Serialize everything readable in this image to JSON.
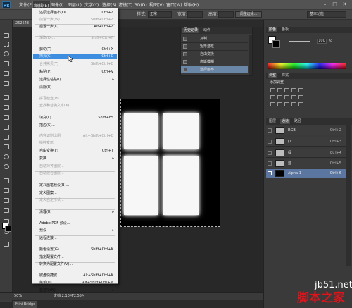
{
  "app": {
    "logo": "Ps",
    "menus": [
      "文件(F)",
      "编辑(E)",
      "图像(I)",
      "图层(L)",
      "文字(Y)",
      "选择(S)",
      "滤镜(T)",
      "3D(D)",
      "视图(V)",
      "窗口(W)",
      "帮助(H)"
    ],
    "window_buttons": [
      "–",
      "□",
      "✕"
    ]
  },
  "options_bar": {
    "style_label": "样式:",
    "style_value": "正常",
    "width_label": "宽度:",
    "height_label": "高度:",
    "refine_edge": "调整边缘...",
    "workspace": "基本功能"
  },
  "document": {
    "tab_label": "262643",
    "bottom_tab": "Mini Bridge"
  },
  "edit_menu": {
    "items": [
      {
        "label": "还原选择画布(O)",
        "shortcut": "Ctrl+Z",
        "disabled": false
      },
      {
        "label": "前进一步(W)",
        "shortcut": "Shift+Ctrl+Z",
        "disabled": true
      },
      {
        "label": "后退一步(K)",
        "shortcut": "Alt+Ctrl+Z",
        "disabled": false
      },
      {
        "label": "渐隐(D)...",
        "shortcut": "Shift+Ctrl+F",
        "disabled": true
      },
      {
        "label": "剪切(T)",
        "shortcut": "Ctrl+X",
        "disabled": false
      },
      {
        "label": "拷贝(C)",
        "shortcut": "Ctrl+C",
        "disabled": false,
        "highlighted": true
      },
      {
        "label": "合并拷贝(Y)",
        "shortcut": "Shift+Ctrl+C",
        "disabled": true
      },
      {
        "label": "粘贴(P)",
        "shortcut": "Ctrl+V",
        "disabled": false
      },
      {
        "label": "选择性粘贴(I)",
        "shortcut": "",
        "disabled": false,
        "submenu": true
      },
      {
        "label": "清除(E)",
        "shortcut": "",
        "disabled": false
      },
      {
        "label": "拼写检查(H)...",
        "shortcut": "",
        "disabled": true
      },
      {
        "label": "查找和替换文本(X)...",
        "shortcut": "",
        "disabled": true
      },
      {
        "label": "填充(L)...",
        "shortcut": "Shift+F5",
        "disabled": false
      },
      {
        "label": "描边(S)...",
        "shortcut": "",
        "disabled": false
      },
      {
        "label": "内容识别比例",
        "shortcut": "Alt+Shift+Ctrl+C",
        "disabled": true
      },
      {
        "label": "操控变形",
        "shortcut": "",
        "disabled": true
      },
      {
        "label": "自由变换(F)",
        "shortcut": "Ctrl+T",
        "disabled": false
      },
      {
        "label": "变换",
        "shortcut": "",
        "disabled": false,
        "submenu": true
      },
      {
        "label": "自动对齐图层...",
        "shortcut": "",
        "disabled": true
      },
      {
        "label": "自动混合图层...",
        "shortcut": "",
        "disabled": true
      },
      {
        "label": "定义画笔预设(B)...",
        "shortcut": "",
        "disabled": false
      },
      {
        "label": "定义图案...",
        "shortcut": "",
        "disabled": false
      },
      {
        "label": "定义自定形状...",
        "shortcut": "",
        "disabled": true
      },
      {
        "label": "清理(R)",
        "shortcut": "",
        "disabled": false,
        "submenu": true
      },
      {
        "label": "Adobe PDF 预设...",
        "shortcut": "",
        "disabled": false
      },
      {
        "label": "预设",
        "shortcut": "",
        "disabled": false,
        "submenu": true
      },
      {
        "label": "远程连接...",
        "shortcut": "",
        "disabled": false
      },
      {
        "label": "颜色设置(G)...",
        "shortcut": "Shift+Ctrl+K",
        "disabled": false
      },
      {
        "label": "指定配置文件...",
        "shortcut": "",
        "disabled": false
      },
      {
        "label": "转换为配置文件(V)...",
        "shortcut": "",
        "disabled": false
      },
      {
        "label": "键盘快捷键...",
        "shortcut": "Alt+Shift+Ctrl+K",
        "disabled": false
      },
      {
        "label": "菜单(U)...",
        "shortcut": "Alt+Shift+Ctrl+M",
        "disabled": false
      },
      {
        "label": "首选项(N)",
        "shortcut": "",
        "disabled": false,
        "submenu": true
      }
    ]
  },
  "history_panel": {
    "tabs": [
      "历史记录",
      "动作"
    ],
    "items": [
      "复制",
      "矩形选框",
      "自由变换",
      "高斯模糊",
      "选择画布"
    ]
  },
  "color_panel": {
    "tabs": [
      "颜色",
      "色板"
    ],
    "slider_value": "100",
    "slider_unit": "%"
  },
  "adjustments_panel": {
    "tabs": [
      "调整",
      "样式"
    ],
    "title": "添加调整"
  },
  "channels_panel": {
    "tabs": [
      "图层",
      "通道",
      "路径"
    ],
    "channels": [
      {
        "name": "RGB",
        "shortcut": "Ctrl+2"
      },
      {
        "name": "红",
        "shortcut": "Ctrl+3"
      },
      {
        "name": "绿",
        "shortcut": "Ctrl+4"
      },
      {
        "name": "蓝",
        "shortcut": "Ctrl+5"
      },
      {
        "name": "Alpha 1",
        "shortcut": "Ctrl+6",
        "selected": true
      }
    ]
  },
  "status": {
    "zoom": "50%",
    "doc_info": "文档:2.10M/2.55M"
  },
  "watermark": {
    "url": "jb51.net",
    "site": "脚本之家"
  }
}
